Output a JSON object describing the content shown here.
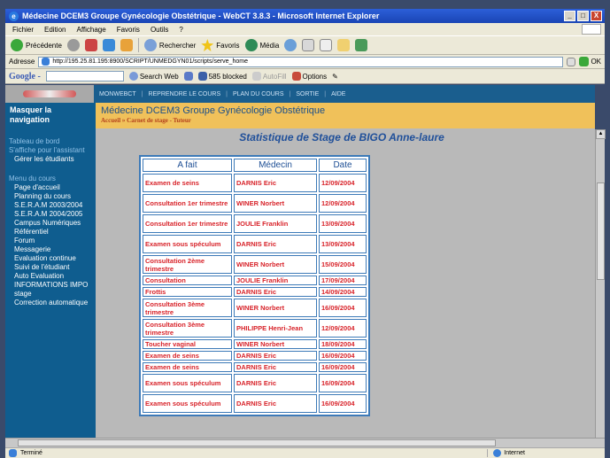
{
  "window": {
    "title": "Médecine DCEM3 Groupe Gynécologie Obstétrique - WebCT 3.8.3 - Microsoft Internet Explorer",
    "buttons": [
      "_",
      "□",
      "X"
    ]
  },
  "menu": [
    "Fichier",
    "Edition",
    "Affichage",
    "Favoris",
    "Outils",
    "?"
  ],
  "toolbar": {
    "back": "Précédente",
    "search": "Rechercher",
    "favorites": "Favoris",
    "media": "Média"
  },
  "address": {
    "label": "Adresse",
    "url": "http://195.25.81.195:8900/SCRIPT/UNMEDGYN01/scripts/serve_home",
    "go": "OK"
  },
  "google": {
    "logo": "Google -",
    "search_web": "Search Web",
    "blocked": "585 blocked",
    "autofill": "AutoFill",
    "options": "Options"
  },
  "webct_nav": [
    "MONWEBCT",
    "REPRENDRE LE COURS",
    "PLAN DU COURS",
    "SORTIE",
    "AIDE"
  ],
  "sidebar": {
    "hide_nav": "Masquer la navigation",
    "groups": [
      {
        "title": "Tableau de bord",
        "items": []
      },
      {
        "title": "S'affiche pour l'assistant",
        "items": [
          "Gérer les étudiants"
        ]
      },
      {
        "title": "Menu du cours",
        "items": [
          "Page d'accueil",
          "Planning du cours",
          "S.E.R.A.M 2003/2004",
          "S.E.R.A.M 2004/2005",
          "Campus Numériques",
          "Référentiel",
          "Forum",
          "Messagerie",
          "Evaluation continue",
          "Suivi de l'étudiant",
          "Auto Evaluation",
          "INFORMATIONS IMPO",
          "stage",
          "Correction automatique"
        ]
      }
    ]
  },
  "header": {
    "course_title": "Médecine DCEM3 Groupe Gynécologie Obstétrique",
    "breadcrumb_home": "Accueil",
    "breadcrumb_sep": "»",
    "breadcrumb_current": "Carnet de stage - Tuteur"
  },
  "page": {
    "title": "Statistique de Stage de BIGO Anne-laure"
  },
  "table": {
    "headers": [
      "A fait",
      "Médecin",
      "Date"
    ],
    "rows": [
      [
        "Examen de seins",
        "DARNIS Eric",
        "12/09/2004"
      ],
      [
        "Consultation 1er trimestre",
        "WINER Norbert",
        "12/09/2004"
      ],
      [
        "Consultation 1er trimestre",
        "JOULIE Franklin",
        "13/09/2004"
      ],
      [
        "Examen sous spéculum",
        "DARNIS Eric",
        "13/09/2004"
      ],
      [
        "Consultation 2ème trimestre",
        "WINER Norbert",
        "15/09/2004"
      ],
      [
        "Consultation",
        "JOULIE Franklin",
        "17/09/2004"
      ],
      [
        "Frottis",
        "DARNIS Eric",
        "14/09/2004"
      ],
      [
        "Consultation 3ème trimestre",
        "WINER Norbert",
        "16/09/2004"
      ],
      [
        "Consultation 3ème trimestre",
        "PHILIPPE Henri-Jean",
        "12/09/2004"
      ],
      [
        "Toucher vaginal",
        "WINER Norbert",
        "18/09/2004"
      ],
      [
        "Examen de seins",
        "DARNIS Eric",
        "16/09/2004"
      ],
      [
        "Examen de seins",
        "DARNIS Eric",
        "16/09/2004"
      ],
      [
        "Examen sous spéculum",
        "DARNIS Eric",
        "16/09/2004"
      ],
      [
        "Examen sous spéculum",
        "DARNIS Eric",
        "16/09/2004"
      ]
    ]
  },
  "status": {
    "left": "Terminé",
    "zone": "Internet"
  }
}
